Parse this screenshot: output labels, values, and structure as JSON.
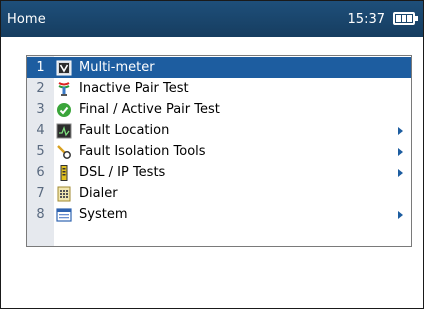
{
  "header": {
    "title": "Home",
    "time": "15:37",
    "battery_icon": "battery-full-icon"
  },
  "menu": {
    "items": [
      {
        "number": "1",
        "label": "Multi-meter",
        "icon": "multimeter-icon",
        "selected": true,
        "submenu": false
      },
      {
        "number": "2",
        "label": "Inactive Pair Test",
        "icon": "pair-test-icon",
        "selected": false,
        "submenu": false
      },
      {
        "number": "3",
        "label": "Final / Active Pair Test",
        "icon": "check-circle-icon",
        "selected": false,
        "submenu": false
      },
      {
        "number": "4",
        "label": "Fault Location",
        "icon": "waveform-icon",
        "selected": false,
        "submenu": true
      },
      {
        "number": "5",
        "label": "Fault Isolation Tools",
        "icon": "probe-icon",
        "selected": false,
        "submenu": true
      },
      {
        "number": "6",
        "label": "DSL / IP Tests",
        "icon": "dsl-modem-icon",
        "selected": false,
        "submenu": true
      },
      {
        "number": "7",
        "label": "Dialer",
        "icon": "keypad-icon",
        "selected": false,
        "submenu": false
      },
      {
        "number": "8",
        "label": "System",
        "icon": "system-window-icon",
        "selected": false,
        "submenu": true
      }
    ]
  },
  "colors": {
    "header_bg": "#1e4f7a",
    "selected_bg": "#1d5da0",
    "number_column_bg": "#e6e9ee"
  }
}
